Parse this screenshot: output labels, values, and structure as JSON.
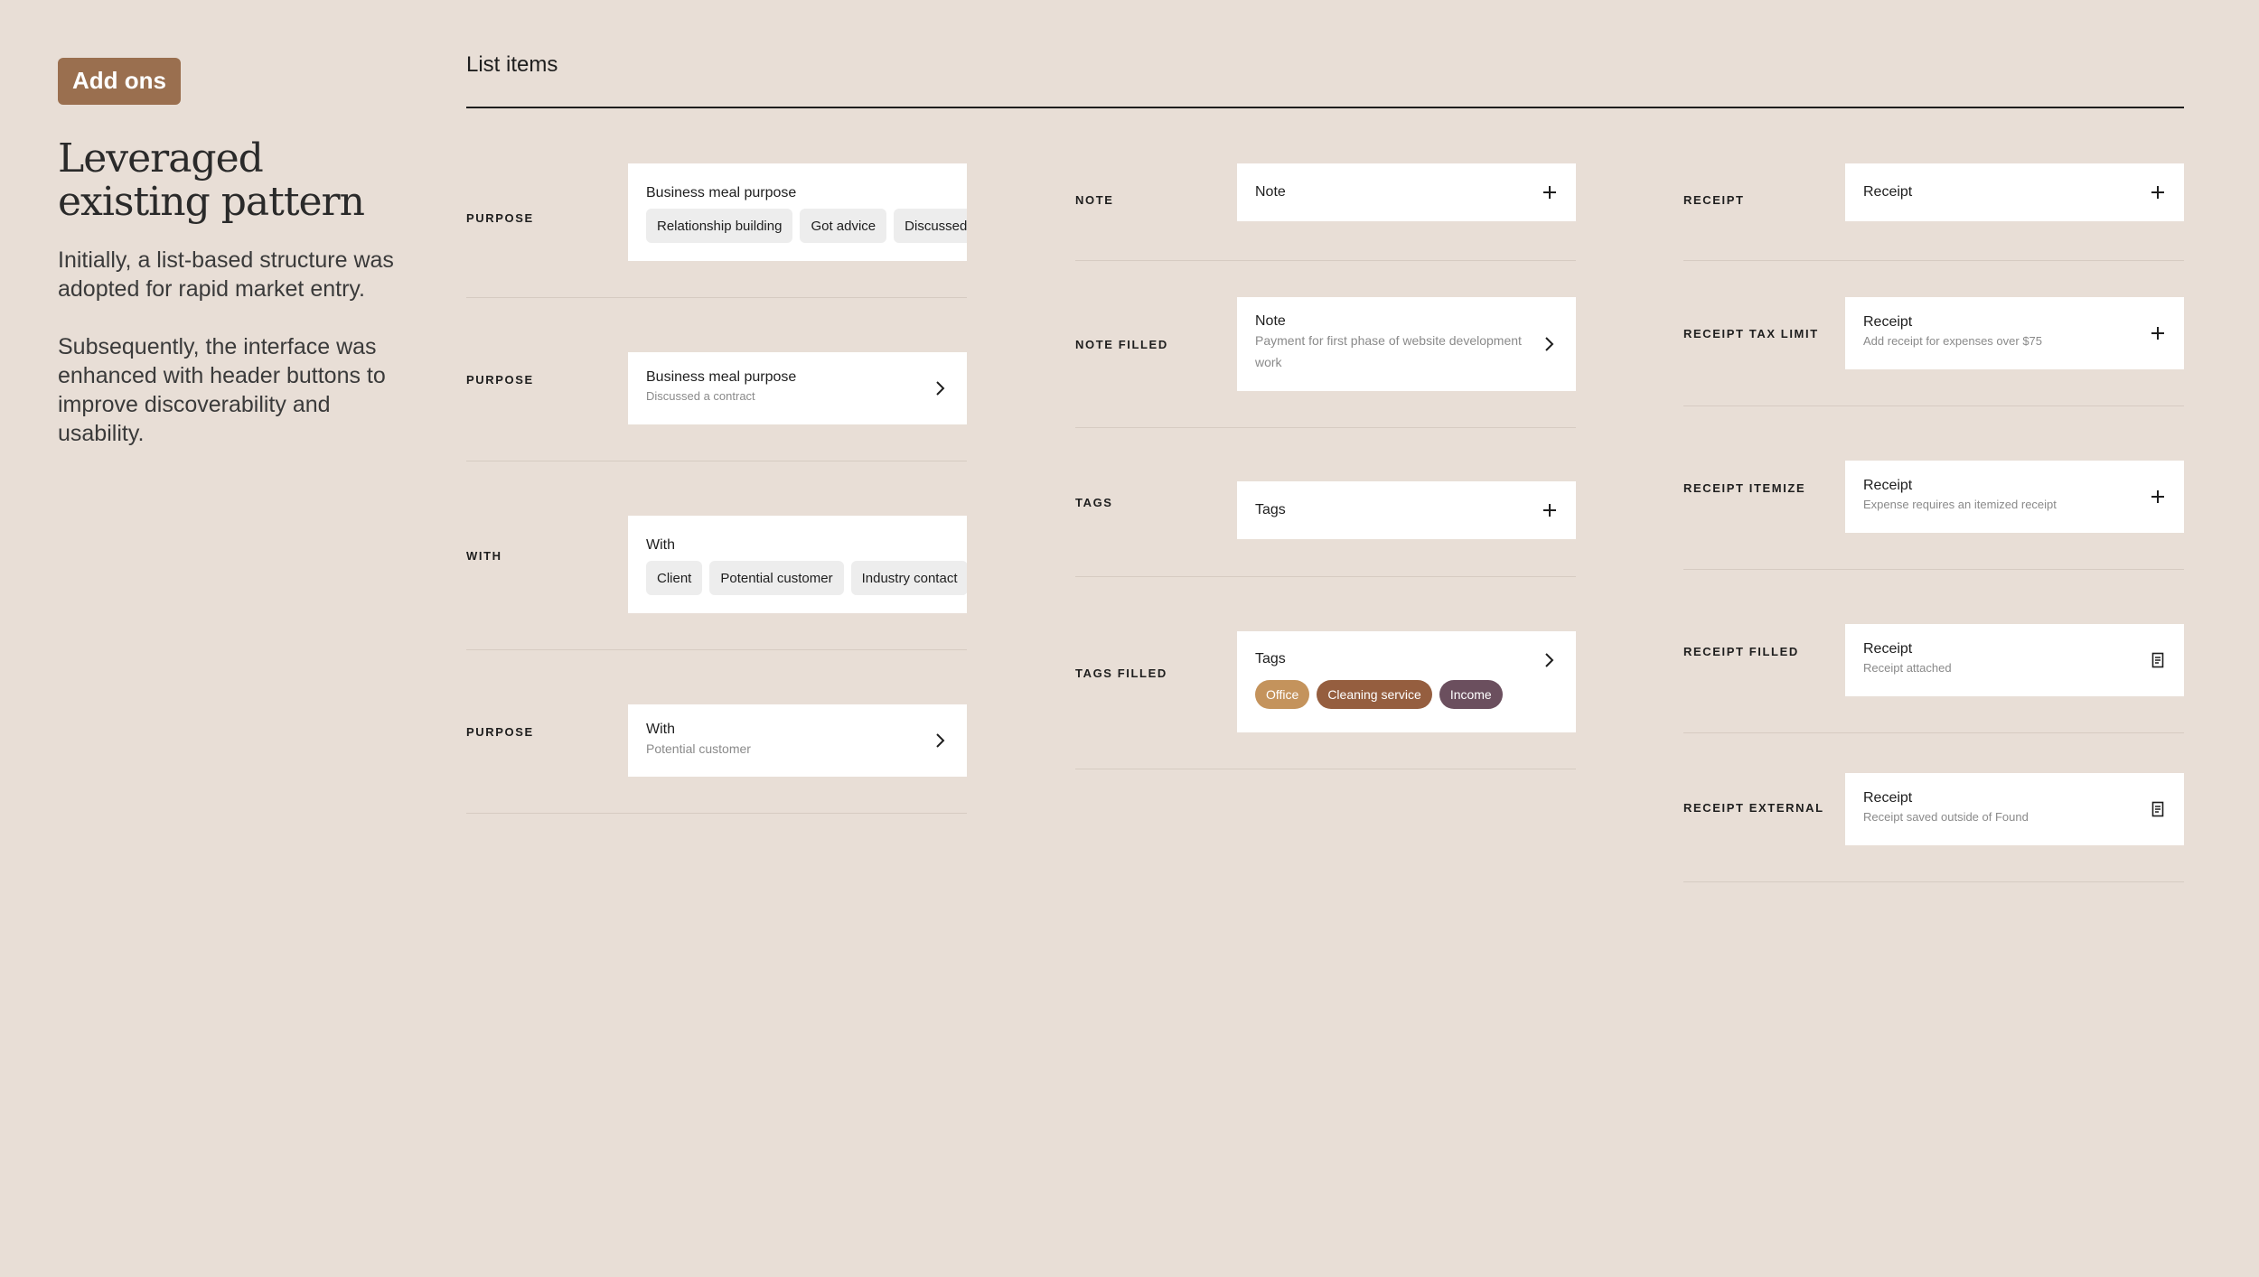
{
  "sidebar": {
    "badge": "Add ons",
    "headline": "Leveraged existing pattern",
    "paragraph1": "Initially, a list-based structure was adopted for rapid market entry.",
    "paragraph2": "Subsequently, the interface was enhanced with header buttons to improve discoverability and usability."
  },
  "section_title": "List items",
  "col1": [
    {
      "label": "PURPOSE",
      "title": "Business meal purpose",
      "chips": [
        "Relationship building",
        "Got advice",
        "Discussed a contract"
      ]
    },
    {
      "label": "PURPOSE",
      "title": "Business meal purpose",
      "subtitle": "Discussed a contract",
      "icon": "chevron-right-icon"
    },
    {
      "label": "WITH",
      "title": "With",
      "chips": [
        "Client",
        "Potential customer",
        "Industry contact"
      ]
    },
    {
      "label": "PURPOSE",
      "title": "With",
      "subtitle": "Potential customer",
      "icon": "chevron-right-icon"
    }
  ],
  "col2": [
    {
      "label": "NOTE",
      "title": "Note",
      "icon": "plus-icon"
    },
    {
      "label": "NOTE FILLED",
      "title": "Note",
      "subtitle": "Payment for first phase of website development work",
      "icon": "chevron-right-icon"
    },
    {
      "label": "TAGS",
      "title": "Tags",
      "icon": "plus-icon"
    },
    {
      "label": "TAGS FILLED",
      "title": "Tags",
      "tags": [
        "Office",
        "Cleaning service",
        "Income"
      ],
      "icon": "chevron-right-icon"
    }
  ],
  "col3": [
    {
      "label": "RECEIPT",
      "title": "Receipt",
      "icon": "plus-icon"
    },
    {
      "label": "RECEIPT TAX LIMIT",
      "title": "Receipt",
      "subtitle": "Add receipt for expenses over $75",
      "icon": "plus-icon"
    },
    {
      "label": "RECEIPT ITEMIZE",
      "title": "Receipt",
      "subtitle": "Expense requires an itemized receipt",
      "icon": "plus-icon"
    },
    {
      "label": "RECEIPT FILLED",
      "title": "Receipt",
      "subtitle": "Receipt attached",
      "icon": "receipt-icon"
    },
    {
      "label": "RECEIPT EXTERNAL",
      "title": "Receipt",
      "subtitle": "Receipt saved outside of Found",
      "icon": "receipt-icon"
    }
  ],
  "colors": {
    "background": "#e8ded6",
    "badge": "#9a6f4f",
    "tag_office": "#c4935c",
    "tag_cleaning": "#955e3f",
    "tag_income": "#6b4f5e"
  }
}
